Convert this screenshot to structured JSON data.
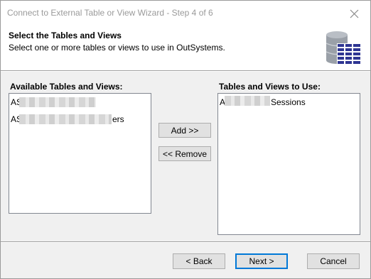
{
  "window": {
    "title": "Connect to External Table or View Wizard - Step 4 of 6"
  },
  "header": {
    "title": "Select the Tables and Views",
    "subtitle": "Select one or more tables or views to use in OutSystems.",
    "icon": "database-table-icon"
  },
  "available": {
    "label": "Available Tables and Views:",
    "items": [
      {
        "visible_text_prefix": "AS",
        "visible_text_suffix": ""
      },
      {
        "visible_text_prefix": "AS",
        "visible_text_suffix": "ers"
      }
    ]
  },
  "selected": {
    "label": "Tables and Views to Use:",
    "items": [
      {
        "visible_text_prefix": "A",
        "visible_text_suffix": "Sessions"
      }
    ]
  },
  "actions": {
    "add_label": "Add >>",
    "remove_label": "<< Remove"
  },
  "footer": {
    "back_label": "< Back",
    "next_label": "Next >",
    "cancel_label": "Cancel"
  },
  "colors": {
    "default_button_border": "#0078d7",
    "db_icon_blue": "#2e3592",
    "db_icon_gray": "#9aa0a8"
  }
}
